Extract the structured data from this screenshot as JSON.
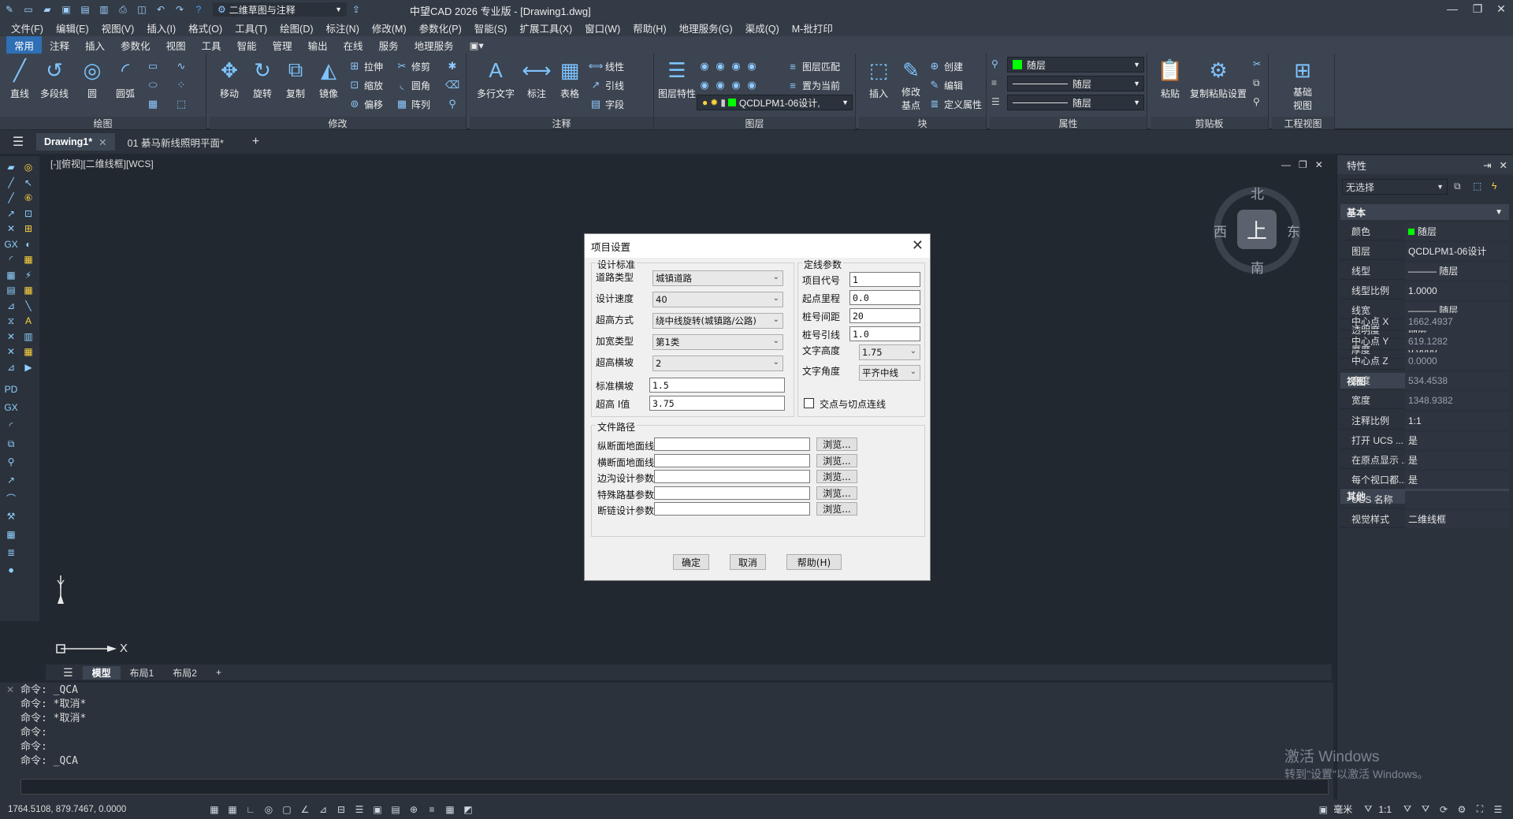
{
  "titlebar": {
    "workspace": "二维草图与注释",
    "title": "中望CAD 2026 专业版 - [Drawing1.dwg]"
  },
  "menu": [
    "文件(F)",
    "编辑(E)",
    "视图(V)",
    "插入(I)",
    "格式(O)",
    "工具(T)",
    "绘图(D)",
    "标注(N)",
    "修改(M)",
    "参数化(P)",
    "智能(S)",
    "扩展工具(X)",
    "窗口(W)",
    "帮助(H)",
    "地理服务(G)",
    "渠成(Q)",
    "M-批打印"
  ],
  "ribbon_tabs": [
    "常用",
    "注释",
    "插入",
    "参数化",
    "视图",
    "工具",
    "智能",
    "管理",
    "输出",
    "在线",
    "服务",
    "地理服务"
  ],
  "ribbon": {
    "draw": {
      "title": "绘图",
      "line": "直线",
      "polyline": "多段线",
      "circle": "圆",
      "arc": "圆弧"
    },
    "modify": {
      "title": "修改",
      "move": "移动",
      "rotate": "旋转",
      "copy": "复制",
      "mirror": "镜像",
      "stretch": "拉伸",
      "scale": "缩放",
      "offset": "偏移",
      "trim": "修剪",
      "fillet": "圆角",
      "array": "阵列"
    },
    "annotation": {
      "title": "注释",
      "mtext": "多行文字",
      "dim": "标注",
      "table": "表格",
      "linear": "线性",
      "leader": "引线",
      "field": "字段"
    },
    "layers": {
      "title": "图层",
      "props": "图层特性",
      "match": "图层匹配",
      "setcurrent": "置为当前",
      "current_layer": "QCDLPM1-06设计,"
    },
    "block": {
      "title": "块",
      "insert": "插入",
      "edit_base": "修改基点",
      "create": "创建",
      "edit": "编辑",
      "define_attr": "定义属性"
    },
    "properties": {
      "title": "属性",
      "color": "随层",
      "linetype": "随层",
      "lineweight": "随层"
    },
    "clipboard": {
      "title": "剪贴板",
      "paste": "粘贴",
      "copy_base": "复制粘贴设置"
    },
    "engview": {
      "title": "工程视图",
      "base": "基础视图"
    }
  },
  "doc_tabs": [
    "Drawing1*",
    "01 綦马新线照明平面*"
  ],
  "view_label": "[-][俯视][二维线框][WCS]",
  "compass": {
    "north": "北",
    "south": "南",
    "east": "东",
    "west": "西",
    "top": "上"
  },
  "axis": {
    "x": "X",
    "y": "Y"
  },
  "model_tabs": [
    "模型",
    "布局1",
    "布局2"
  ],
  "command_lines": [
    "命令: _QCA",
    "命令: *取消*",
    "命令: *取消*",
    "命令:",
    "命令:",
    "命令: _QCA"
  ],
  "status": {
    "coords": "1764.5108, 879.7467, 0.0000",
    "unit": "毫米",
    "scale": "1:1"
  },
  "props_panel": {
    "title": "特性",
    "selection": "无选择",
    "sections": {
      "basic": "基本",
      "view": "视图",
      "misc": "其他"
    },
    "basic": [
      {
        "k": "颜色",
        "v": "随层"
      },
      {
        "k": "图层",
        "v": "QCDLPM1-06设计"
      },
      {
        "k": "线型",
        "v": "——— 随层"
      },
      {
        "k": "线型比例",
        "v": "1.0000"
      },
      {
        "k": "线宽",
        "v": "——— 随层"
      },
      {
        "k": "透明度",
        "v": "随层"
      },
      {
        "k": "厚度",
        "v": "0.0000"
      }
    ],
    "view": [
      {
        "k": "中心点 X",
        "v": "1662.4937"
      },
      {
        "k": "中心点 Y",
        "v": "619.1282"
      },
      {
        "k": "中心点 Z",
        "v": "0.0000"
      },
      {
        "k": "高度",
        "v": "534.4538"
      },
      {
        "k": "宽度",
        "v": "1348.9382"
      }
    ],
    "misc": [
      {
        "k": "注释比例",
        "v": "1:1"
      },
      {
        "k": "打开 UCS ...",
        "v": "是"
      },
      {
        "k": "在原点显示 ...",
        "v": "是"
      },
      {
        "k": "每个视口都...",
        "v": "是"
      },
      {
        "k": "UCS 名称",
        "v": ""
      },
      {
        "k": "视觉样式",
        "v": "二维线框"
      }
    ]
  },
  "watermark": {
    "line1": "激活 Windows",
    "line2": "转到\"设置\"以激活 Windows。"
  },
  "dialog": {
    "title": "项目设置",
    "design_std": {
      "title": "设计标准",
      "road_type_label": "道路类型",
      "road_type": "城镇道路",
      "speed_label": "设计速度",
      "speed": "40",
      "super_method_label": "超高方式",
      "super_method": "绕中线旋转(城镇路/公路)",
      "widen_label": "加宽类型",
      "widen": "第1类",
      "super_slope_label": "超高横坡",
      "super_slope": "2",
      "std_slope_label": "标准横坡",
      "std_slope": "1.5",
      "super_max_label": "超高 I值",
      "super_max": "3.75"
    },
    "alignment": {
      "title": "定线参数",
      "code_label": "项目代号",
      "code": "1",
      "start_label": "起点里程",
      "start": "0.0",
      "spacing_label": "桩号间距",
      "spacing": "20",
      "leader_label": "桩号引线",
      "leader": "1.0",
      "text_h_label": "文字高度",
      "text_h": "1.75",
      "text_angle_label": "文字角度",
      "text_angle": "平齐中线",
      "tangent_label": "交点与切点连线"
    },
    "paths": {
      "title": "文件路径",
      "rows": [
        "纵断面地面线",
        "横断面地面线",
        "边沟设计参数",
        "特殊路基参数",
        "断链设计参数"
      ],
      "browse": "浏览..."
    },
    "ok": "确定",
    "cancel": "取消",
    "help": "帮助(H)"
  }
}
